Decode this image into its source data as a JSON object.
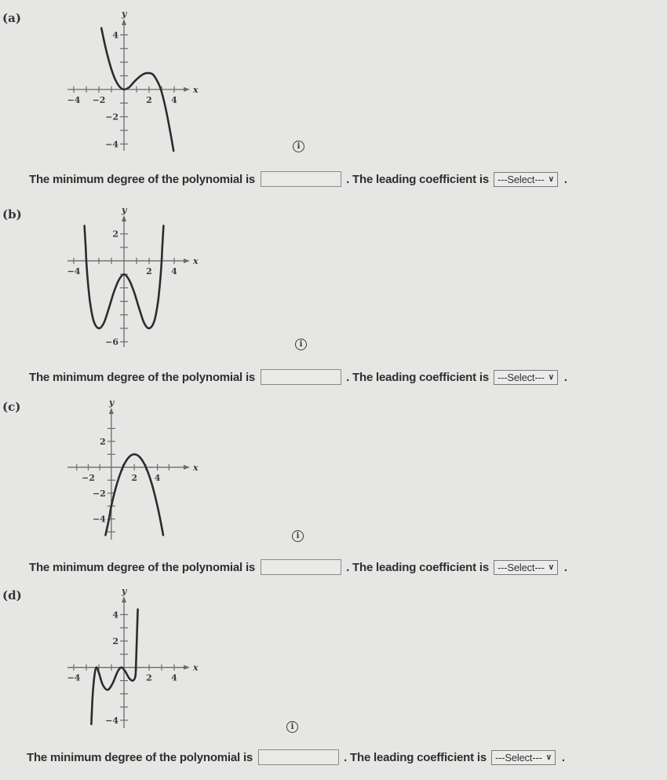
{
  "question_template": {
    "prefix": "The minimum degree of the polynomial is",
    "middle": ". The leading coefficient is",
    "suffix": ".",
    "input_value": "",
    "select_value": "---Select---",
    "select_chevron": "∨"
  },
  "info_icon_glyph": "i",
  "parts": [
    {
      "label": "(a)",
      "chart_data": {
        "type": "line",
        "title": "",
        "xlabel": "x",
        "ylabel": "y",
        "x_ticks": [
          -4,
          -3,
          -2,
          -1,
          1,
          2,
          3,
          4
        ],
        "x_tick_labels": [
          {
            "v": -4,
            "t": "−4"
          },
          {
            "v": -2,
            "t": "−2"
          },
          {
            "v": 2,
            "t": "2"
          },
          {
            "v": 4,
            "t": "4"
          }
        ],
        "y_ticks": [
          -4,
          -3,
          -2,
          -1,
          1,
          2,
          3,
          4
        ],
        "y_tick_labels": [
          {
            "v": 4,
            "t": "4"
          },
          {
            "v": -2,
            "t": "−2"
          },
          {
            "v": -4,
            "t": "−4"
          }
        ],
        "xlim": [
          -4.5,
          4.5
        ],
        "ylim": [
          -4.5,
          4.6
        ],
        "points": [
          [
            -1.8,
            4.5
          ],
          [
            -1.5,
            3.2
          ],
          [
            -1.2,
            2.1
          ],
          [
            -0.9,
            1.2
          ],
          [
            -0.6,
            0.55
          ],
          [
            -0.3,
            0.15
          ],
          [
            0,
            0
          ],
          [
            0.4,
            0.15
          ],
          [
            0.8,
            0.55
          ],
          [
            1.2,
            0.9
          ],
          [
            1.6,
            1.15
          ],
          [
            2,
            1.2
          ],
          [
            2.3,
            1.1
          ],
          [
            2.6,
            0.7
          ],
          [
            2.9,
            0.1
          ],
          [
            3.2,
            -0.9
          ],
          [
            3.5,
            -2.2
          ],
          [
            3.8,
            -3.7
          ],
          [
            3.95,
            -4.5
          ]
        ]
      }
    },
    {
      "label": "(b)",
      "chart_data": {
        "type": "line",
        "title": "",
        "xlabel": "x",
        "ylabel": "y",
        "x_ticks": [
          -4,
          -3,
          -2,
          -1,
          1,
          2,
          3,
          4
        ],
        "x_tick_labels": [
          {
            "v": -4,
            "t": "−4"
          },
          {
            "v": 2,
            "t": "2"
          },
          {
            "v": 4,
            "t": "4"
          }
        ],
        "y_ticks": [
          -6,
          -5,
          -4,
          -3,
          -2,
          -1,
          1,
          2
        ],
        "y_tick_labels": [
          {
            "v": 2,
            "t": "2"
          },
          {
            "v": -6,
            "t": "−6"
          }
        ],
        "xlim": [
          -4.5,
          4.5
        ],
        "ylim": [
          -6.4,
          2.8
        ],
        "points": [
          [
            -3.15,
            2.6
          ],
          [
            -3.05,
            1
          ],
          [
            -3,
            0
          ],
          [
            -2.9,
            -1.3
          ],
          [
            -2.7,
            -3.1
          ],
          [
            -2.4,
            -4.5
          ],
          [
            -2,
            -5
          ],
          [
            -1.6,
            -4.6
          ],
          [
            -1.2,
            -3.5
          ],
          [
            -0.8,
            -2.3
          ],
          [
            -0.4,
            -1.4
          ],
          [
            0,
            -1
          ],
          [
            0.4,
            -1.4
          ],
          [
            0.8,
            -2.3
          ],
          [
            1.2,
            -3.5
          ],
          [
            1.6,
            -4.6
          ],
          [
            2,
            -5
          ],
          [
            2.4,
            -4.5
          ],
          [
            2.7,
            -3.1
          ],
          [
            2.9,
            -1.3
          ],
          [
            3,
            0
          ],
          [
            3.05,
            1
          ],
          [
            3.15,
            2.6
          ]
        ]
      }
    },
    {
      "label": "(c)",
      "chart_data": {
        "type": "line",
        "title": "",
        "xlabel": "x",
        "ylabel": "y",
        "x_ticks": [
          -3,
          -2,
          -1,
          1,
          2,
          3,
          4,
          5
        ],
        "x_tick_labels": [
          {
            "v": -2,
            "t": "−2"
          },
          {
            "v": 2,
            "t": "2"
          },
          {
            "v": 4,
            "t": "4"
          }
        ],
        "y_ticks": [
          -5,
          -4,
          -3,
          -2,
          -1,
          1,
          2,
          3
        ],
        "y_tick_labels": [
          {
            "v": 2,
            "t": "2"
          },
          {
            "v": -2,
            "t": "−2"
          },
          {
            "v": -4,
            "t": "−4"
          }
        ],
        "xlim": [
          -3.8,
          6
        ],
        "ylim": [
          -5.6,
          4
        ],
        "points": [
          [
            -0.5,
            -5.25
          ],
          [
            -0.2,
            -4
          ],
          [
            0,
            -3
          ],
          [
            0.4,
            -1.56
          ],
          [
            0.8,
            -0.44
          ],
          [
            1.2,
            0.36
          ],
          [
            1.6,
            0.84
          ],
          [
            2,
            1
          ],
          [
            2.4,
            0.84
          ],
          [
            2.8,
            0.36
          ],
          [
            3.2,
            -0.44
          ],
          [
            3.6,
            -1.56
          ],
          [
            4,
            -3
          ],
          [
            4.3,
            -4.29
          ],
          [
            4.5,
            -5.25
          ]
        ]
      }
    },
    {
      "label": "(d)",
      "chart_data": {
        "type": "line",
        "title": "",
        "xlabel": "x",
        "ylabel": "y",
        "x_ticks": [
          -4,
          -3,
          -2,
          -1,
          1,
          2,
          3,
          4
        ],
        "x_tick_labels": [
          {
            "v": -4,
            "t": "−4"
          },
          {
            "v": 2,
            "t": "2"
          },
          {
            "v": 4,
            "t": "4"
          }
        ],
        "y_ticks": [
          -4,
          -3,
          -2,
          -1,
          1,
          2,
          3,
          4
        ],
        "y_tick_labels": [
          {
            "v": 4,
            "t": "4"
          },
          {
            "v": 2,
            "t": "2"
          },
          {
            "v": -4,
            "t": "−4"
          }
        ],
        "xlim": [
          -4.5,
          4.5
        ],
        "ylim": [
          -4.6,
          4.8
        ],
        "points": [
          [
            -2.6,
            -4.3
          ],
          [
            -2.5,
            -2.2
          ],
          [
            -2.35,
            -0.6
          ],
          [
            -2.2,
            0
          ],
          [
            -2.0,
            -0.4
          ],
          [
            -1.7,
            -1.3
          ],
          [
            -1.3,
            -1.7
          ],
          [
            -0.9,
            -1.2
          ],
          [
            -0.5,
            -0.3
          ],
          [
            -0.2,
            0
          ],
          [
            0.1,
            -0.3
          ],
          [
            0.4,
            -0.8
          ],
          [
            0.7,
            -1.0
          ],
          [
            0.9,
            -0.7
          ],
          [
            0.95,
            0
          ],
          [
            1.0,
            1.5
          ],
          [
            1.05,
            3.0
          ],
          [
            1.1,
            4.4
          ]
        ]
      }
    }
  ]
}
